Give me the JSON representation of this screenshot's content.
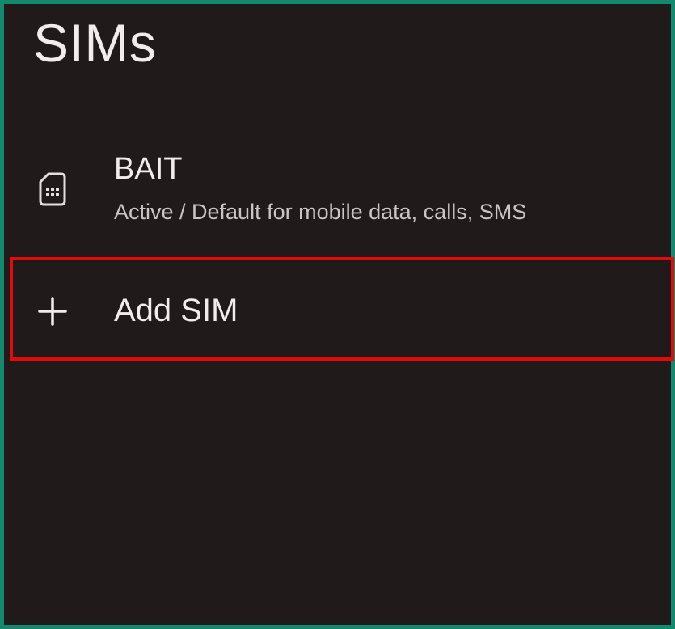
{
  "page": {
    "title": "SIMs"
  },
  "sims": [
    {
      "name": "BAIT",
      "status": "Active / Default for mobile data, calls, SMS",
      "icon": "sim-card-icon"
    }
  ],
  "actions": {
    "add_sim_label": "Add SIM",
    "add_sim_icon": "plus-icon"
  },
  "colors": {
    "background": "#201a1b",
    "frame": "#138a6d",
    "highlight": "#e20a0a",
    "primary_text": "#f2ecec",
    "secondary_text": "#cfc4c5"
  }
}
